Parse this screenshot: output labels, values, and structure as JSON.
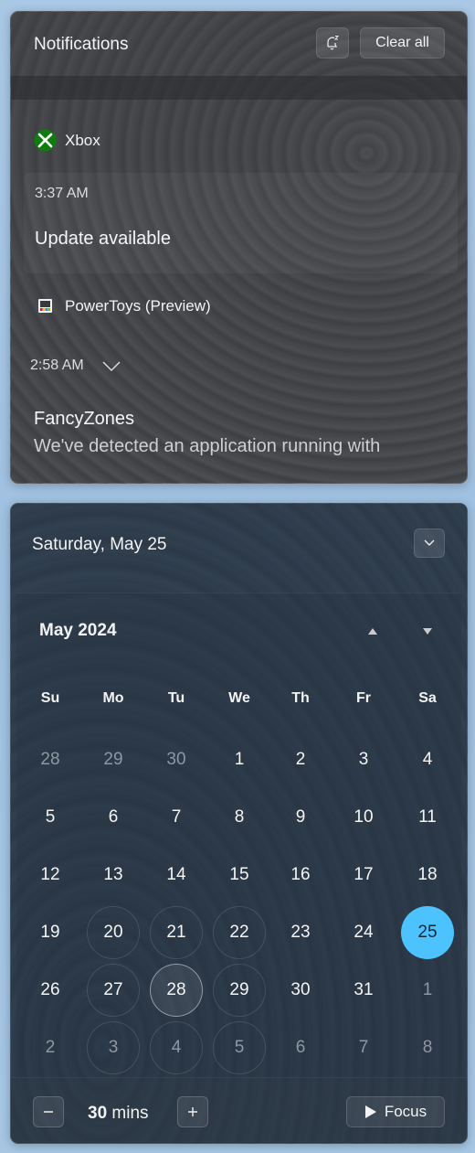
{
  "notifications": {
    "title": "Notifications",
    "clear_all_label": "Clear all",
    "snooze_icon": "snooze-bell-icon",
    "groups": [
      {
        "app": "Xbox",
        "icon": "xbox-icon",
        "time": "3:37 AM",
        "title": "Update available",
        "body": ""
      },
      {
        "app": "PowerToys (Preview)",
        "icon": "powertoys-icon",
        "time": "2:58 AM",
        "title": "FancyZones",
        "body": "We've detected an application running with"
      }
    ]
  },
  "calendar": {
    "date_label": "Saturday, May 25",
    "month_label": "May 2024",
    "weekdays": [
      "Su",
      "Mo",
      "Tu",
      "We",
      "Th",
      "Fr",
      "Sa"
    ],
    "weeks": [
      [
        "28",
        "29",
        "30",
        "1",
        "2",
        "3",
        "4"
      ],
      [
        "5",
        "6",
        "7",
        "8",
        "9",
        "10",
        "11"
      ],
      [
        "12",
        "13",
        "14",
        "15",
        "16",
        "17",
        "18"
      ],
      [
        "19",
        "20",
        "21",
        "22",
        "23",
        "24",
        "25"
      ],
      [
        "26",
        "27",
        "28",
        "29",
        "30",
        "31",
        "1"
      ],
      [
        "2",
        "3",
        "4",
        "5",
        "6",
        "7",
        "8"
      ]
    ],
    "today": "25",
    "focus": {
      "minus_icon": "minus-icon",
      "plus_icon": "plus-icon",
      "duration_value": "30",
      "duration_unit": "mins",
      "focus_label": "Focus",
      "accent_color": "#4cc2ff"
    }
  }
}
